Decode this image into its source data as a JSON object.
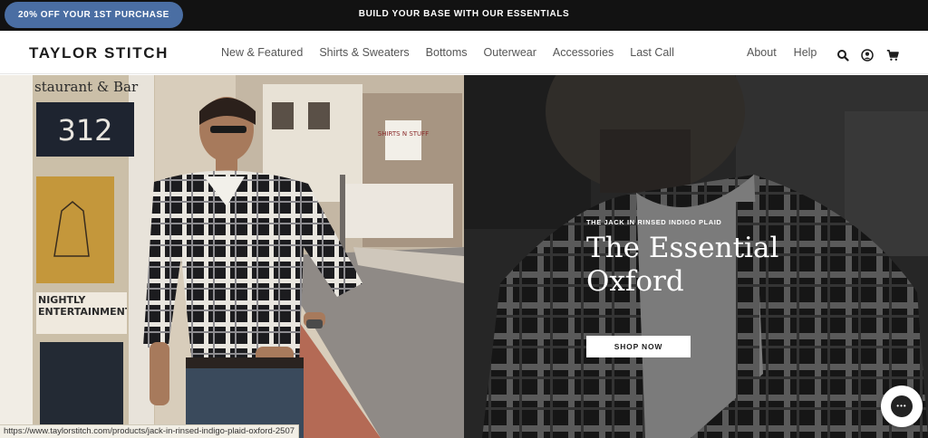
{
  "announcement": {
    "promo": "20% OFF YOUR 1ST PURCHASE",
    "message": "BUILD YOUR BASE WITH OUR ESSENTIALS"
  },
  "header": {
    "logo": "TAYLOR STITCH",
    "nav": [
      "New & Featured",
      "Shirts & Sweaters",
      "Bottoms",
      "Outerwear",
      "Accessories",
      "Last Call"
    ],
    "secondary_nav": [
      "About",
      "Help"
    ],
    "icons": [
      "search-icon",
      "account-icon",
      "cart-icon"
    ]
  },
  "hero": {
    "kicker": "THE JACK IN RINSED INDIGO PLAID",
    "headline_line1": "The Essential",
    "headline_line2": "Oxford",
    "cta": "SHOP NOW",
    "storefront_signs": [
      "staurant & Bar",
      "312",
      "SHIRTS N STUFF",
      "NIGHTLY ENTERTAINMENT"
    ]
  },
  "status_bar": {
    "url": "https://www.taylorstitch.com/products/jack-in-rinsed-indigo-plaid-oxford-2507"
  },
  "colors": {
    "announcement_bg": "#121212",
    "promo_pill": "#4a6ea3",
    "header_bg": "#ffffff",
    "text_dark": "#1b1b1b"
  }
}
